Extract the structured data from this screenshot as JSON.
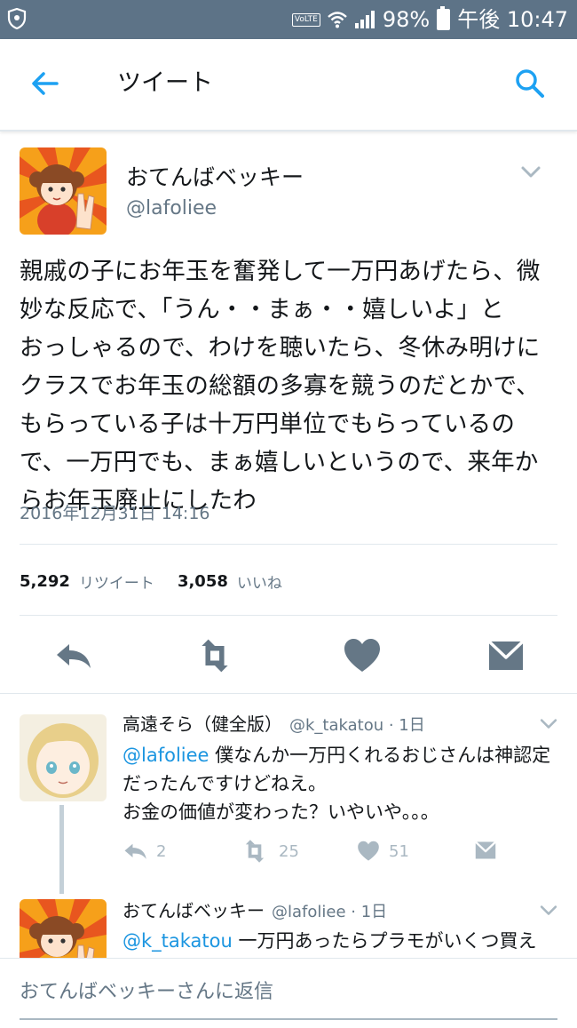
{
  "status_bar": {
    "volte": "VoLTE",
    "battery": "98%",
    "time": "午後 10:47"
  },
  "header": {
    "title": "ツイート"
  },
  "tweet": {
    "author_name": "おてんばベッキー",
    "author_handle": "@lafoliee",
    "text": "親戚の子にお年玉を奮発して一万円あげたら、微\n妙な反応で、「うん・・まぁ・・嬉しいよ」と\nおっしゃるので、わけを聴いたら、冬休み明けに\nクラスでお年玉の総額の多寡を競うのだとかで、\nもらっている子は十万円単位でもらっているの\nで、一万円でも、まぁ嬉しいというので、来年か\nらお年玉廃止にしたわ",
    "timestamp": "2016年12月31日 14:16",
    "retweet_count": "5,292",
    "retweet_label": "リツイート",
    "like_count": "3,058",
    "like_label": "いいね"
  },
  "replies": [
    {
      "name": "高遠そら（健全版）",
      "meta": "@k_takatou · 1日",
      "mention": "@lafoliee",
      "text_after_mention": " 僕なんか一万円くれるおじさんは神認定",
      "text_rest": "だったんですけどねえ。\nお金の価値が変わった？いやいや。。。",
      "reply_count": "2",
      "retweet_count": "25",
      "like_count": "51"
    },
    {
      "name": "おてんばベッキー",
      "meta": "@lafoliee · 1日",
      "mention": "@k_takatou",
      "text_after_mention": " 一万円あったらプラモがいくつ買え"
    }
  ],
  "composer": {
    "placeholder": "おてんばベッキーさんに返信"
  },
  "colors": {
    "accent": "#1da1f2",
    "status_bar": "#5d7387",
    "secondary_text": "#657786",
    "action_icon": "#657786",
    "reply_action_icon": "#aab8c2"
  }
}
